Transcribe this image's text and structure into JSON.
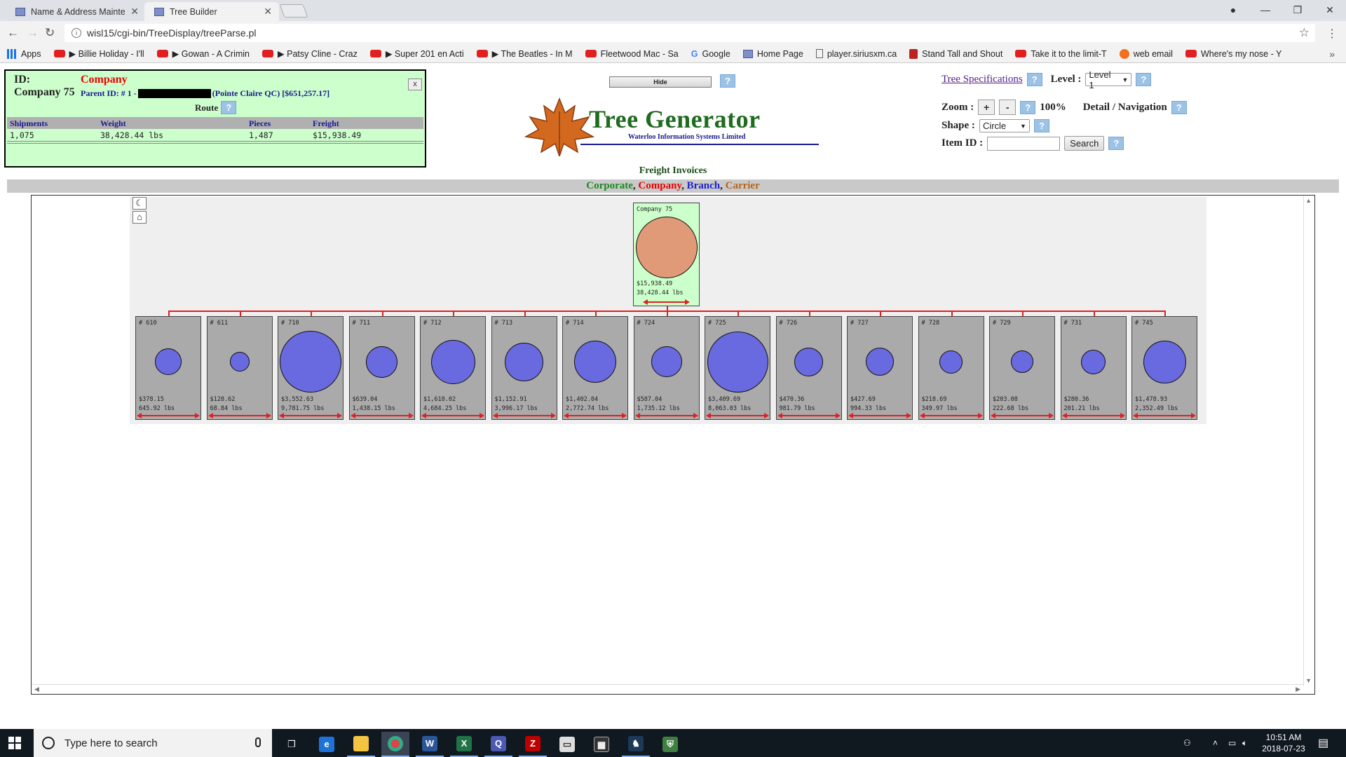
{
  "browser": {
    "tabs": [
      {
        "title": "Name & Address Mainte",
        "active": false
      },
      {
        "title": "Tree Builder",
        "active": true
      }
    ],
    "url": "wisl15/cgi-bin/TreeDisplay/treeParse.pl",
    "bookmarks": [
      {
        "label": "Apps",
        "icon": "apps-grid-icon"
      },
      {
        "label": "▶ Billie Holiday - I'll",
        "icon": "youtube-icon"
      },
      {
        "label": "▶ Gowan - A Crimin",
        "icon": "youtube-icon"
      },
      {
        "label": "▶ Patsy Cline - Craz",
        "icon": "youtube-icon"
      },
      {
        "label": "▶ Super 201 en Acti",
        "icon": "youtube-icon"
      },
      {
        "label": "▶ The Beatles - In M",
        "icon": "youtube-icon"
      },
      {
        "label": "Fleetwood Mac - Sa",
        "icon": "youtube-icon"
      },
      {
        "label": "Google",
        "icon": "google-icon"
      },
      {
        "label": "Home Page",
        "icon": "wisl-icon"
      },
      {
        "label": "player.siriusxm.ca",
        "icon": "page-icon"
      },
      {
        "label": "Stand Tall and Shout",
        "icon": "bookmark-icon"
      },
      {
        "label": "Take it to the limit-T",
        "icon": "youtube-icon"
      },
      {
        "label": "web email",
        "icon": "cpanel-icon"
      },
      {
        "label": "Where's my nose - Y",
        "icon": "youtube-icon"
      }
    ]
  },
  "info_panel": {
    "id_label": "ID:",
    "type": "Company",
    "name": "Company 75",
    "parent_prefix": "Parent ID: # 1 -",
    "parent_suffix": "(Pointe Claire QC) [$651,257.17]",
    "route_label": "Route",
    "close_label": "x",
    "columns": [
      "Shipments",
      "Weight",
      "Pieces",
      "Freight"
    ],
    "values": [
      "1,075",
      "38,428.44 lbs",
      "1,487",
      "$15,938.49"
    ]
  },
  "header": {
    "hide_label": "Hide",
    "brand": "Tree Generator",
    "company": "Waterloo Information Systems Limited",
    "subtitle": "Freight Invoices",
    "legend": {
      "corporate": "Corporate",
      "company": "Company",
      "branch": "Branch",
      "carrier": "Carrier"
    },
    "colors": {
      "corporate": "#1b8a1b",
      "company": "#e00000",
      "branch": "#2020d0",
      "carrier": "#b8651a"
    }
  },
  "controls": {
    "tree_specs": "Tree Specifications",
    "level_label": "Level :",
    "level_value": "Level 1",
    "zoom_label": "Zoom :",
    "zoom_plus": "+",
    "zoom_minus": "-",
    "zoom_value": "100%",
    "detail_label": "Detail / Navigation",
    "shape_label": "Shape :",
    "shape_value": "Circle",
    "item_label": "Item ID :",
    "search_label": "Search",
    "help": "?"
  },
  "tree": {
    "root": {
      "label": "Company 75",
      "freight": "$15,938.49",
      "weight": "38,428.44 lbs"
    },
    "children": [
      {
        "label": "# 610",
        "freight": "$378.15",
        "weight": "645.92 lbs",
        "size": 0.33
      },
      {
        "label": "# 611",
        "freight": "$128.62",
        "weight": "68.84 lbs",
        "size": 0.19
      },
      {
        "label": "# 710",
        "freight": "$3,552.63",
        "weight": "9,781.75 lbs",
        "size": 1.0
      },
      {
        "label": "# 711",
        "freight": "$639.04",
        "weight": "1,438.15 lbs",
        "size": 0.42
      },
      {
        "label": "# 712",
        "freight": "$1,618.02",
        "weight": "4,684.25 lbs",
        "size": 0.66
      },
      {
        "label": "# 713",
        "freight": "$1,152.91",
        "weight": "3,996.17 lbs",
        "size": 0.56
      },
      {
        "label": "# 714",
        "freight": "$1,402.04",
        "weight": "2,772.74 lbs",
        "size": 0.62
      },
      {
        "label": "# 724",
        "freight": "$587.04",
        "weight": "1,735.12 lbs",
        "size": 0.41
      },
      {
        "label": "# 725",
        "freight": "$3,409.69",
        "weight": "8,063.03 lbs",
        "size": 0.98
      },
      {
        "label": "# 726",
        "freight": "$470.36",
        "weight": "981.79 lbs",
        "size": 0.37
      },
      {
        "label": "# 727",
        "freight": "$427.69",
        "weight": "994.33 lbs",
        "size": 0.35
      },
      {
        "label": "# 728",
        "freight": "$218.69",
        "weight": "349.97 lbs",
        "size": 0.25
      },
      {
        "label": "# 729",
        "freight": "$203.08",
        "weight": "222.68 lbs",
        "size": 0.24
      },
      {
        "label": "# 731",
        "freight": "$280.36",
        "weight": "201.21 lbs",
        "size": 0.29
      },
      {
        "label": "# 745",
        "freight": "$1,478.93",
        "weight": "2,352.49 lbs",
        "size": 0.64
      }
    ]
  },
  "taskbar": {
    "search_placeholder": "Type here to search",
    "time": "10:51 AM",
    "date": "2018-07-23"
  }
}
